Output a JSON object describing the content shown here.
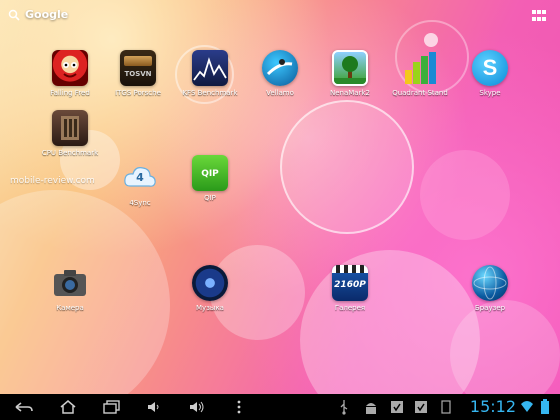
{
  "search": {
    "label": "Google"
  },
  "apps": [
    {
      "label": "Falling Fred"
    },
    {
      "label": "ITGS Porsche"
    },
    {
      "label": "KFS Benchmark"
    },
    {
      "label": "Vellamo"
    },
    {
      "label": "NenaMark2"
    },
    {
      "label": "Quadrant Stand"
    },
    {
      "label": "Skype"
    },
    {
      "label": "CPU Benchmark"
    },
    {
      "label": "4Sync"
    },
    {
      "label": "QIP"
    },
    {
      "label": "Камера"
    },
    {
      "label": "Музыка"
    },
    {
      "label": "Галерея"
    },
    {
      "label": "Браузер"
    }
  ],
  "icon_text": {
    "itgs": "TOSVN",
    "sync": "4",
    "qip": "QIP",
    "gallery": "2160P"
  },
  "watermark": "mobile-review.com",
  "statusbar": {
    "time": "15:12"
  },
  "colors": {
    "clock": "#36b6f0",
    "navbar": "#000000"
  }
}
